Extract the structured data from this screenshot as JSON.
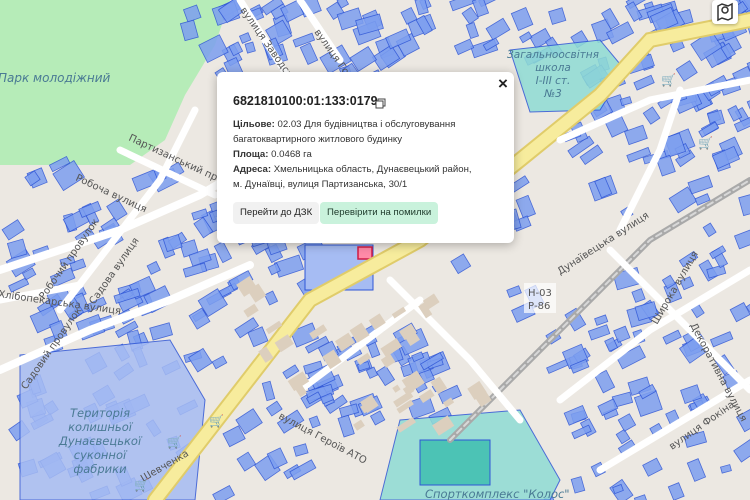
{
  "colors": {
    "park": "#b6ecb8",
    "parcel_fill": "#7d9ff0",
    "parcel_stroke": "#2f56d6",
    "road_main": "#f7ec9d",
    "road_main_edge": "#e0cc6a",
    "road_minor": "#ffffff",
    "rail": "#a9a9a9",
    "building": "#dccfbe",
    "label_blue": "#4a7a94",
    "shop_icon": "#b023b0",
    "button_check": "#c9f2dc"
  },
  "map": {
    "park_label": "Парк молодіжний",
    "school_label_lines": [
      "Загальноосвітня",
      "школа",
      "І-ІІІ ст.",
      "№3"
    ],
    "factory_label_lines": [
      "Територія",
      "колишньої",
      "Дунаєвецької",
      "суконної",
      "фабрики"
    ],
    "stadium_label": "Спорткомплекс \"Колос\"",
    "road_code_1": "Н-03",
    "road_code_2": "Р-86",
    "streets": [
      "вулиця Заводська",
      "вулиця Гоголя",
      "Партизанський провулок",
      "Робоча вулиця",
      "Робочий провулок",
      "Садова вулиця",
      "Хлібопекарська вулиця",
      "Садовий провулок",
      "вулиця Героїв АТО",
      "Шевченка",
      "Дунаївецька вулиця",
      "Широка вулиця",
      "Декоративна вулиця",
      "вулиця Фокіна"
    ],
    "map_button_icon": "map-pin-icon",
    "shop_icon": "shopping-cart-icon"
  },
  "popup": {
    "cadastral_number": "6821810100:01:133:0179",
    "purpose_label": "Цільове:",
    "purpose_value": "02.03 Для будівництва і обслуговування багатоквартирного житлового будинку",
    "area_label": "Площа:",
    "area_value": "0.0468 га",
    "address_label": "Адреса:",
    "address_value": "Хмельницька область, Дунаєвецький район, м. Дунаївці, вулиця Партизанська, 30/1",
    "button_dzk": "Перейти до ДЗК",
    "button_check": "Перевірити на помилки",
    "close_icon": "close-icon",
    "copy_icon": "copy-icon"
  }
}
